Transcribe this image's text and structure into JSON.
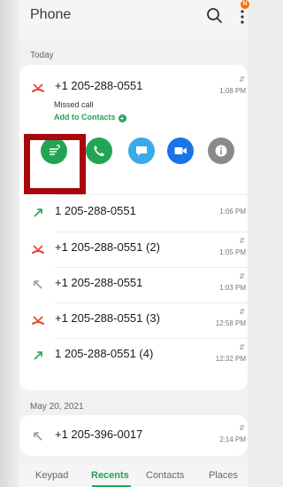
{
  "header": {
    "title": "Phone",
    "badge": "N"
  },
  "sections": {
    "today": "Today",
    "older": "May 20, 2021"
  },
  "expanded_call": {
    "number": "+1 205-288-0551",
    "time": "1:08 PM",
    "status": "Missed call",
    "add_contacts": "Add to Contacts",
    "add_icon": "+"
  },
  "calls_today": [
    {
      "number": "1 205-288-0551",
      "time": "1:06 PM",
      "type": "outgoing"
    },
    {
      "number": "+1 205-288-0551 (2)",
      "time": "1:05 PM",
      "type": "missed"
    },
    {
      "number": "+1 205-288-0551",
      "time": "1:03 PM",
      "type": "rejected"
    },
    {
      "number": "+1 205-288-0551 (3)",
      "time": "12:58 PM",
      "type": "missed"
    },
    {
      "number": "1 205-288-0551 (4)",
      "time": "12:32 PM",
      "type": "outgoing"
    }
  ],
  "calls_older": [
    {
      "number": "+1 205-396-0017",
      "time": "2:14 PM",
      "type": "rejected"
    }
  ],
  "actions": [
    {
      "icon": "message-icon",
      "color": "#23a455"
    },
    {
      "icon": "phone-icon",
      "color": "#23a455"
    },
    {
      "icon": "chat-icon",
      "color": "#3aaae8"
    },
    {
      "icon": "video-icon",
      "color": "#1a73e8"
    },
    {
      "icon": "info-icon",
      "color": "#8a8a8a"
    }
  ],
  "nav": {
    "keypad": "Keypad",
    "recents": "Recents",
    "contacts": "Contacts",
    "places": "Places"
  },
  "colors": {
    "accent": "#23a455",
    "missed": "#e5412c",
    "highlight": "#a8070e"
  }
}
